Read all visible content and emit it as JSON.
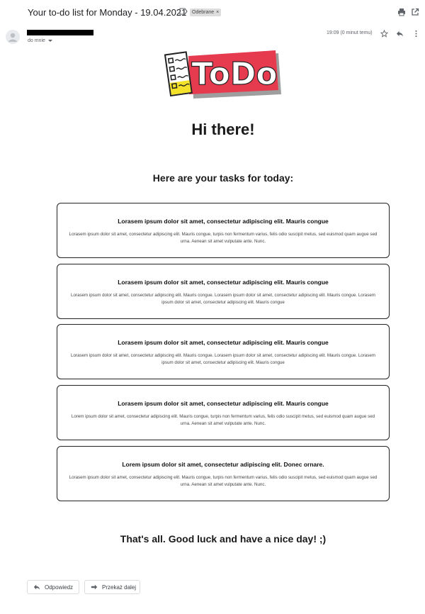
{
  "email": {
    "subject": "Your to-do list for Monday - 19.04.2021",
    "label_chip": "Odebrane",
    "label_chip_close": "×",
    "recipient_line": "do mnie",
    "time": "19:09 (0 minut temu)"
  },
  "body": {
    "logo_text": "ToDo",
    "greeting": "Hi there!",
    "intro": "Here are your tasks for today:",
    "tasks": [
      {
        "title": "Lorasem ipsum dolor sit amet, consectetur adipiscing elit. Mauris congue",
        "description": "Lorasem ipsum dolor sit amet, consectetur adipiscing elit. Mauris congue, turpis non fermentum varius, felis odio suscipit metus, sed euismod quam augue sed urna. Aenean sit amet vulputate ante. Nunc."
      },
      {
        "title": "Lorasem ipsum dolor sit amet, consectetur adipiscing elit. Mauris congue",
        "description": "Lorasem ipsum dolor sit amet, consectetur adipiscing elit. Mauris congue. Lorasem ipsum dolor sit amet, consectetur adipiscing elit. Mauris congue. Lorasem ipsum dolor sit amet, consectetur adipiscing elit. Mauris congue"
      },
      {
        "title": "Lorasem ipsum dolor sit amet, consectetur adipiscing elit. Mauris congue",
        "description": "Lorasem ipsum dolor sit amet, consectetur adipiscing elit. Mauris congue. Lorasem ipsum dolor sit amet, consectetur adipiscing elit. Mauris congue. Lorasem ipsum dolor sit amet, consectetur adipiscing elit. Mauris congue"
      },
      {
        "title": "Lorasem ipsum dolor sit amet, consectetur adipiscing elit. Mauris congue",
        "description": "Lorem ipsum dolor sit amet, consectetur adipiscing elit. Mauris congue, turpis non fermentum varius, felis odio suscipit metus, sed euismod quam augue sed urna. Aenean sit amet vulputate ante. Nunc."
      },
      {
        "title": "Lorem ipsum dolor sit amet, consectetur adipiscing elit. Donec ornare.",
        "description": "Lorasem ipsum dolor sit amet, consectetur adipiscing elit. Mauris congue, turpis non fermentum varius, felis odio suscipit metus, sed euismod quam augue sed urna. Aenean sit amet vulputate ante. Nunc."
      }
    ],
    "closing": "That's all. Good luck and have a nice day! ;)"
  },
  "actions": {
    "reply_label": "Odpowiedz",
    "forward_label": "Przekaż dalej"
  },
  "colors": {
    "logo_red": "#e63a4e",
    "logo_yellow": "#f4e12a",
    "card_border": "#222222"
  },
  "icons": [
    "label-icon",
    "print-icon",
    "open-in-new-window-icon",
    "avatar-icon",
    "dropdown-arrow-icon",
    "star-icon",
    "reply-icon",
    "more-options-icon",
    "forward-icon"
  ]
}
